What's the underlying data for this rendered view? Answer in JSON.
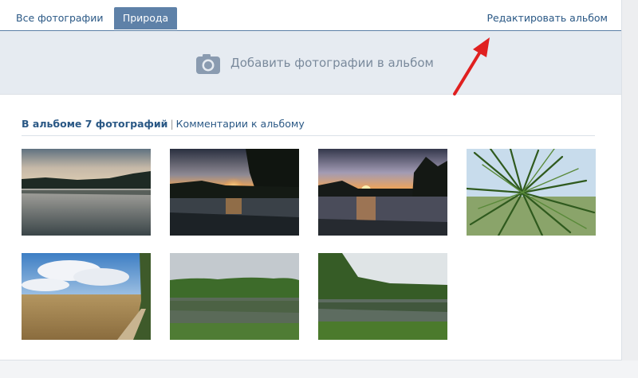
{
  "tabs": {
    "all_photos": "Все фотографии",
    "active_album": "Природа",
    "edit_album": "Редактировать альбом"
  },
  "upload": {
    "label": "Добавить фотографии в альбом",
    "icon": "camera-icon"
  },
  "album": {
    "count_text": "В альбоме 7 фотографий",
    "separator": "|",
    "comments_link": "Комментарии к альбому"
  },
  "photos": [
    {
      "subject": "lake-dusk"
    },
    {
      "subject": "sunset-lake-trees"
    },
    {
      "subject": "sunset-lake-reflection"
    },
    {
      "subject": "pine-branch"
    },
    {
      "subject": "wheat-field-clouds"
    },
    {
      "subject": "lake-forest-overcast"
    },
    {
      "subject": "lake-forest-green"
    }
  ],
  "colors": {
    "accent": "#5e81a8",
    "link": "#2a5885",
    "upload_bar": "#e6ebf1",
    "annotation_arrow": "#e02020"
  }
}
